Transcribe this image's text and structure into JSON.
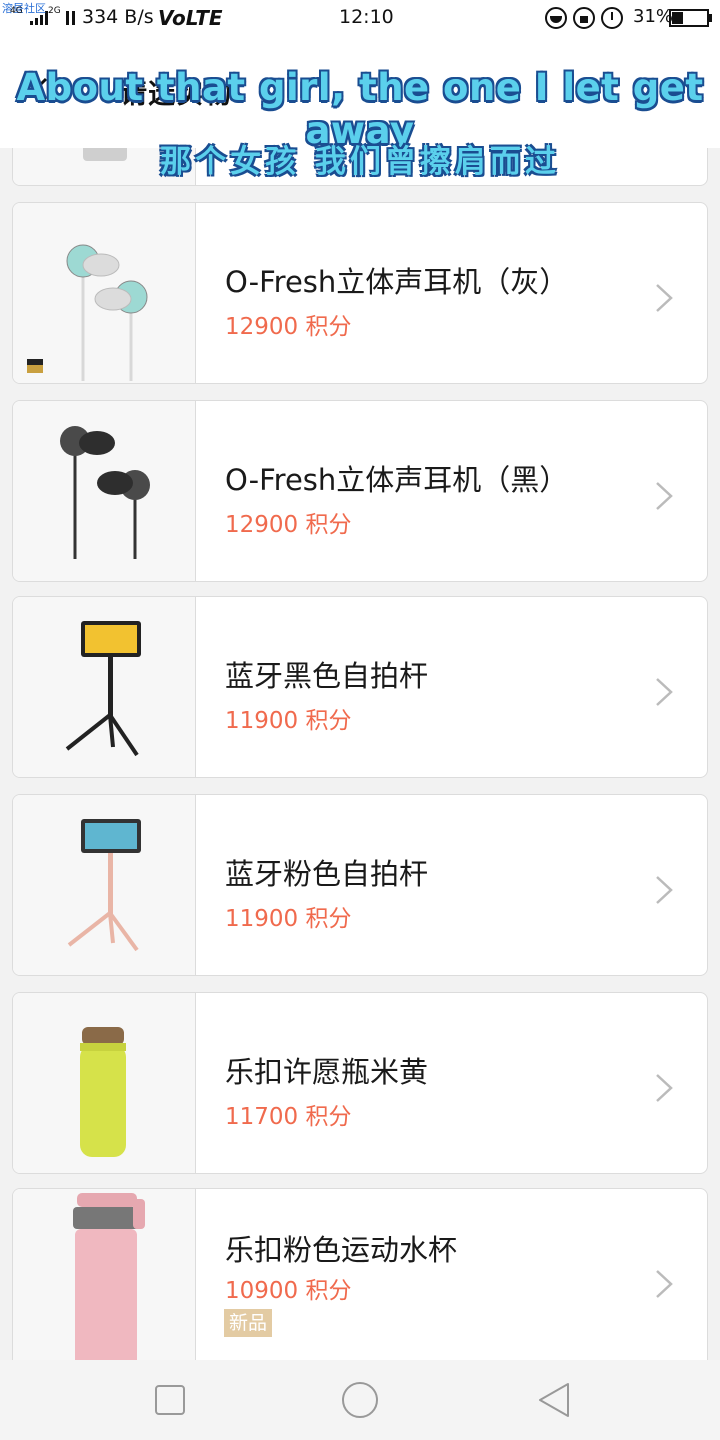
{
  "status_bar": {
    "carrier_overlay": "溶昼社区",
    "network_1": "4G",
    "network_2": "2G",
    "speed": "334 B/s",
    "volte": "VoLTE",
    "time": "12:10",
    "battery_text": "31%",
    "battery_level": 0.31
  },
  "header": {
    "title": "请选实物",
    "lyric_en": "About that girl, the one I let get away",
    "lyric_cn": "那个女孩 我们曾擦肩而过"
  },
  "colors": {
    "price": "#f06a4d",
    "badge": "#e3cba3",
    "lyric_fill": "#5bd0ec",
    "lyric_stroke": "#1a4d91"
  },
  "products": [
    {
      "name": "",
      "price": ""
    },
    {
      "name": "O-Fresh立体声耳机（灰）",
      "price": "12900 积分",
      "image": "gray-earphones",
      "tag": "Hi-Res"
    },
    {
      "name": "O-Fresh立体声耳机（黑）",
      "price": "12900 积分",
      "image": "black-earphones"
    },
    {
      "name": "蓝牙黑色自拍杆",
      "price": "11900 积分",
      "image": "black-selfie-stick"
    },
    {
      "name": "蓝牙粉色自拍杆",
      "price": "11900 积分",
      "image": "pink-selfie-stick"
    },
    {
      "name": "乐扣许愿瓶米黄",
      "price": "11700 积分",
      "image": "yellow-bottle"
    },
    {
      "name": "乐扣粉色运动水杯",
      "price": "10900 积分",
      "image": "pink-sport-bottle",
      "badge": "新品"
    }
  ],
  "nav": {
    "recent_icon": "square-icon",
    "home_icon": "circle-icon",
    "back_icon": "triangle-icon"
  }
}
